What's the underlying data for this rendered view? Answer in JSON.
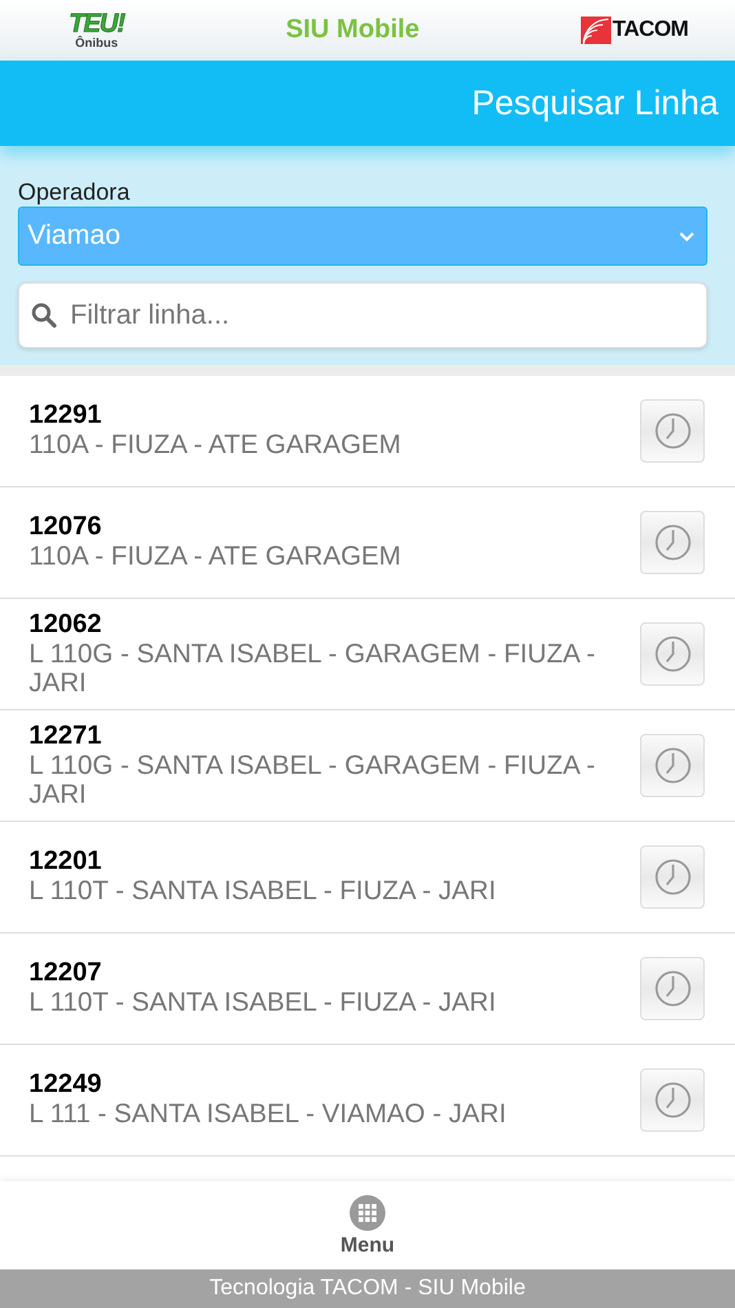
{
  "top_bar": {
    "left_logo": {
      "word": "TEU!",
      "caption": "Ônibus"
    },
    "title": "SIU Mobile",
    "right_logo": {
      "word": "TACOM"
    }
  },
  "header": {
    "title": "Pesquisar Linha"
  },
  "filters": {
    "operator_label": "Operadora",
    "operator_value": "Viamao",
    "search": {
      "placeholder": "Filtrar linha..."
    }
  },
  "lines": [
    {
      "code": "12291",
      "name": "110A - FIUZA - ATE GARAGEM"
    },
    {
      "code": "12076",
      "name": "110A - FIUZA - ATE GARAGEM"
    },
    {
      "code": "12062",
      "name": "L 110G - SANTA ISABEL - GARAGEM - FIUZA - JARI"
    },
    {
      "code": "12271",
      "name": "L 110G - SANTA ISABEL - GARAGEM - FIUZA - JARI"
    },
    {
      "code": "12201",
      "name": "L 110T - SANTA ISABEL - FIUZA - JARI"
    },
    {
      "code": "12207",
      "name": "L 110T - SANTA ISABEL - FIUZA - JARI"
    },
    {
      "code": "12249",
      "name": "L 111 - SANTA ISABEL - VIAMAO - JARI"
    }
  ],
  "menu": {
    "label": "Menu"
  },
  "footer": "Tecnologia TACOM - SIU Mobile"
}
